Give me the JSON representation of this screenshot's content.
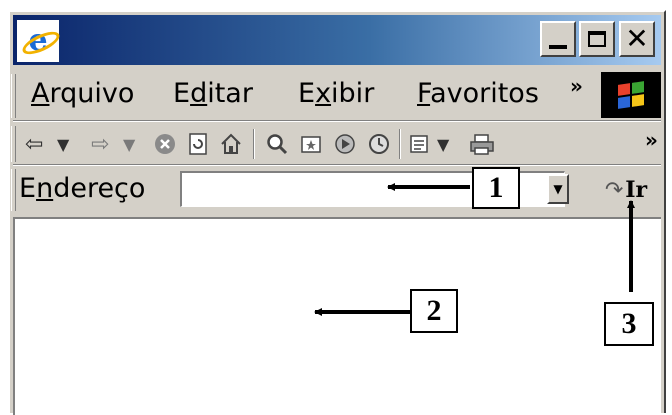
{
  "menubar": {
    "items": [
      {
        "pre": "",
        "accel": "A",
        "post": "rquivo"
      },
      {
        "pre": "E",
        "accel": "d",
        "post": "itar"
      },
      {
        "pre": "E",
        "accel": "x",
        "post": "ibir"
      },
      {
        "pre": "",
        "accel": "F",
        "post": "avoritos"
      }
    ],
    "more": "»"
  },
  "toolbar": {
    "more": "»",
    "icons": [
      "back-icon",
      "forward-icon",
      "stop-icon",
      "refresh-icon",
      "home-icon",
      "search-icon",
      "favorites-icon",
      "media-icon",
      "history-icon",
      "mail-icon",
      "print-icon"
    ]
  },
  "addressbar": {
    "label_pre": "E",
    "label_accel": "n",
    "label_post": "dereço",
    "value": "",
    "go_label": "Ir"
  },
  "callouts": {
    "one": "1",
    "two": "2",
    "three": "3"
  },
  "colors": {
    "title_gradient_start": "#0a246a",
    "title_gradient_end": "#a6caf0",
    "chrome": "#d4d0c8"
  }
}
